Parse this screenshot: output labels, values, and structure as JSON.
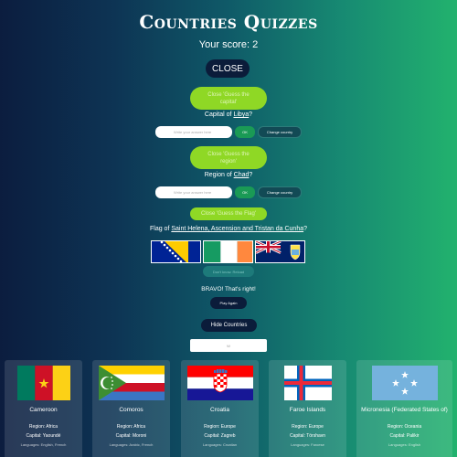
{
  "header": {
    "title": "Countries Quizzes",
    "score": "Your score: 2"
  },
  "close_label": "CLOSE",
  "capital_quiz": {
    "close_label": "Close 'Guess the capital'",
    "question_prefix": "Capital of ",
    "country": "Libya",
    "question_suffix": "?",
    "placeholder": "Write your answer here",
    "ok_label": "OK",
    "change_label": "Change country"
  },
  "region_quiz": {
    "close_label": "Close 'Guess the region'",
    "question_prefix": "Region of ",
    "country": "Chad",
    "question_suffix": "?",
    "placeholder": "Write your answer here",
    "ok_label": "OK",
    "change_label": "Change country"
  },
  "flag_quiz": {
    "close_label": "Close 'Guess the Flag'",
    "question_prefix": "Flag of ",
    "country": "Saint Helena, Ascension and Tristan da Cunha",
    "question_suffix": "?",
    "options": [
      "bosnia-flag",
      "ireland-flag",
      "saint-helena-flag"
    ],
    "dont_know_label": "Don't know. Reload",
    "result": "BRAVO! That's right!",
    "play_again_label": "Play Again"
  },
  "hide_countries_label": "Hide Countries",
  "filter": {
    "placeholder": "W"
  },
  "countries": [
    {
      "name": "Cameroon",
      "region": "Region: Africa",
      "capital": "Capital: Yaoundé",
      "languages": "Languages: English, French",
      "flag": "cameroon-flag"
    },
    {
      "name": "Comoros",
      "region": "Region: Africa",
      "capital": "Capital: Moroni",
      "languages": "Languages: Arabic, French",
      "flag": "comoros-flag"
    },
    {
      "name": "Croatia",
      "region": "Region: Europe",
      "capital": "Capital: Zagreb",
      "languages": "Languages: Croatian",
      "flag": "croatia-flag"
    },
    {
      "name": "Faroe Islands",
      "region": "Region: Europe",
      "capital": "Capital: Tórshavn",
      "languages": "Languages: Faroese",
      "flag": "faroe-flag"
    },
    {
      "name": "Micronesia (Federated States of)",
      "region": "Region: Oceania",
      "capital": "Capital: Palikir",
      "languages": "Languages: English",
      "flag": "micronesia-flag"
    }
  ],
  "colors": {
    "dark_button": "#0b1c3a",
    "green_button": "#8fd825",
    "ok_button": "#1a9a55"
  }
}
